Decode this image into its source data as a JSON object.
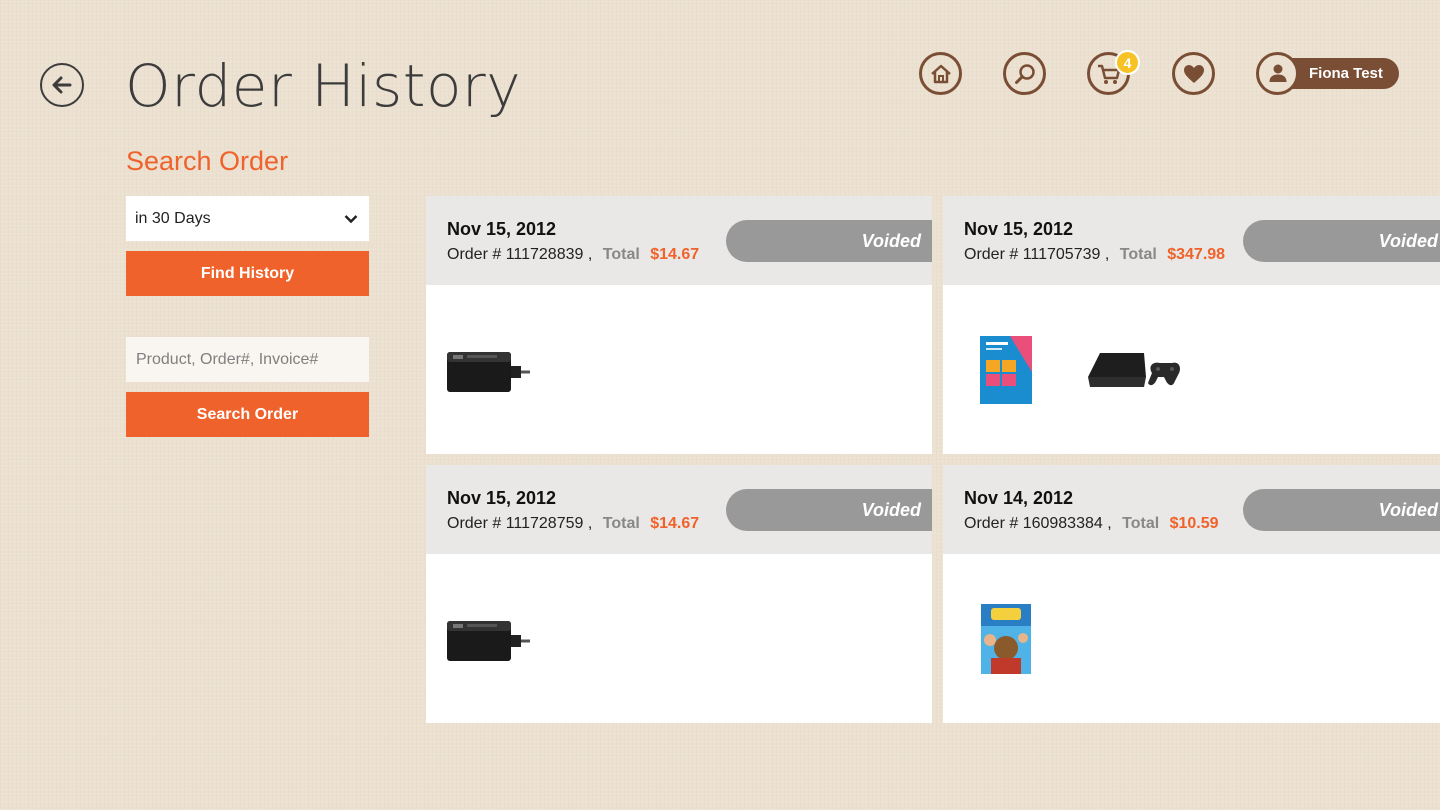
{
  "header": {
    "title": "Order History",
    "cart_count": "4",
    "user_name": "Fiona Test"
  },
  "search": {
    "heading": "Search Order",
    "period_selected": "in 30 Days",
    "find_button": "Find History",
    "query_placeholder": "Product, Order#, Invoice#",
    "query_value": "",
    "search_button": "Search Order"
  },
  "orders": [
    {
      "date": "Nov 15, 2012",
      "order_label": "Order # 111728839 ,",
      "total_label": "Total",
      "total": "$14.67",
      "status": "Voided",
      "items": [
        "usb-adapter"
      ]
    },
    {
      "date": "Nov 15, 2012",
      "order_label": "Order # 111705739 ,",
      "total_label": "Total",
      "total": "$347.98",
      "status": "Voided",
      "items": [
        "windows-8-box",
        "ps3-console"
      ]
    },
    {
      "date": "Nov 15, 2012",
      "order_label": "Order # 111728759 ,",
      "total_label": "Total",
      "total": "$14.67",
      "status": "Voided",
      "items": [
        "usb-adapter"
      ]
    },
    {
      "date": "Nov 14, 2012",
      "order_label": "Order # 160983384 ,",
      "total_label": "Total",
      "total": "$10.59",
      "status": "Voided",
      "items": [
        "dvd-cover"
      ]
    }
  ],
  "colors": {
    "accent": "#f0622b",
    "brown": "#7a4e35",
    "badge": "#f6c224",
    "status_gray": "#999999",
    "background": "#ece1d1"
  }
}
